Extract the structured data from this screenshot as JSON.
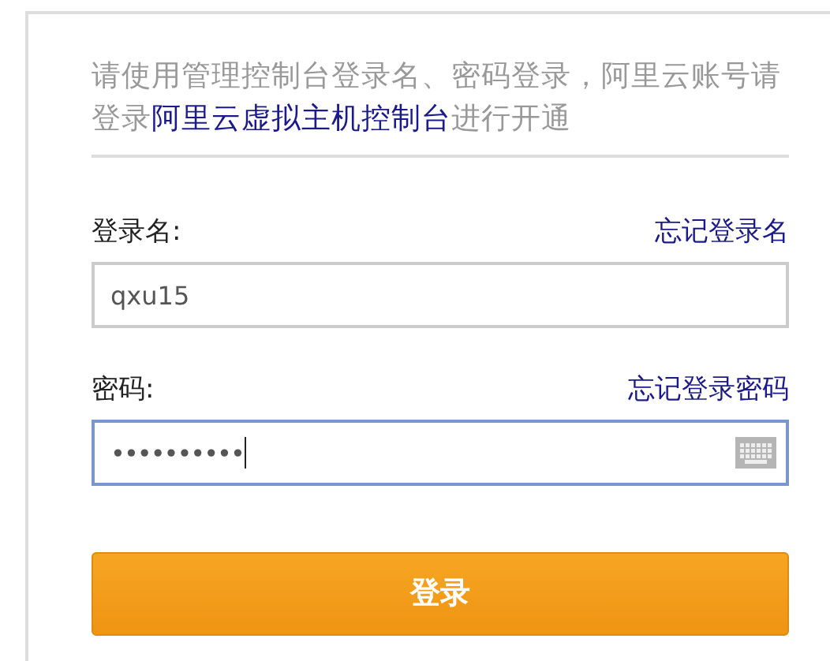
{
  "notice": {
    "text": "请使用管理控制台登录名、密码登录，阿里云账号请登录",
    "link": "阿里云虚拟主机控制台",
    "text_after": "进行开通"
  },
  "fields": [
    {
      "label": "登录名:",
      "link": "忘记登录名",
      "value": "qxu15",
      "kind": "text",
      "focused": false
    },
    {
      "label": "密码:",
      "link": "忘记登录密码",
      "value": "••••••••••",
      "kind": "password",
      "focused": true
    }
  ],
  "button": "登录"
}
